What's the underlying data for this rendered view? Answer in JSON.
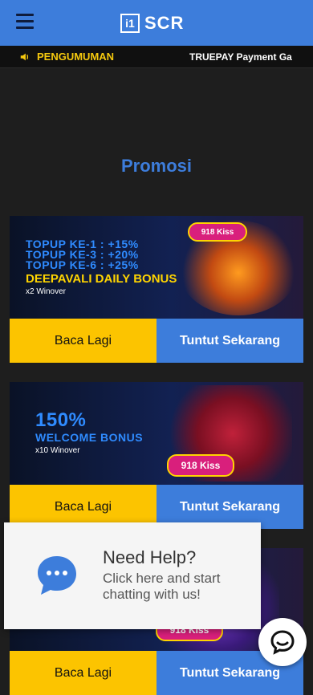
{
  "header": {
    "logo_mark": "i1",
    "logo_text": "SCR"
  },
  "announcement": {
    "label": "PENGUMUMAN",
    "text": "TRUEPAY Payment Ga"
  },
  "page": {
    "title": "Promosi"
  },
  "promos": [
    {
      "lines": [
        "TOPUP KE-1 : +15%",
        "TOPUP KE-3 : +20%",
        "TOPUP KE-6 : +25%"
      ],
      "headline": "DEEPAVALI DAILY BONUS",
      "sub": "x2 Winover",
      "brand": "918 Kiss",
      "read_label": "Baca Lagi",
      "claim_label": "Tuntut Sekarang"
    },
    {
      "percent": "150%",
      "headline": "WELCOME BONUS",
      "sub": "x10 Winover",
      "brand": "918 Kiss",
      "read_label": "Baca Lagi",
      "claim_label": "Tuntut Sekarang"
    },
    {
      "brand": "918 Kiss",
      "read_label": "Baca Lagi",
      "claim_label": "Tuntut Sekarang"
    }
  ],
  "help": {
    "title": "Need Help?",
    "description": "Click here and start chatting with us!"
  },
  "colors": {
    "primary": "#3d7ddb",
    "accent": "#fcc400",
    "background": "#1e1e1e",
    "announce_label": "#f6c90e"
  },
  "icons": {
    "menu": "hamburger-menu-icon",
    "announcement": "speaker-icon",
    "help": "chat-bubble-icon",
    "chat": "chat-icon"
  }
}
